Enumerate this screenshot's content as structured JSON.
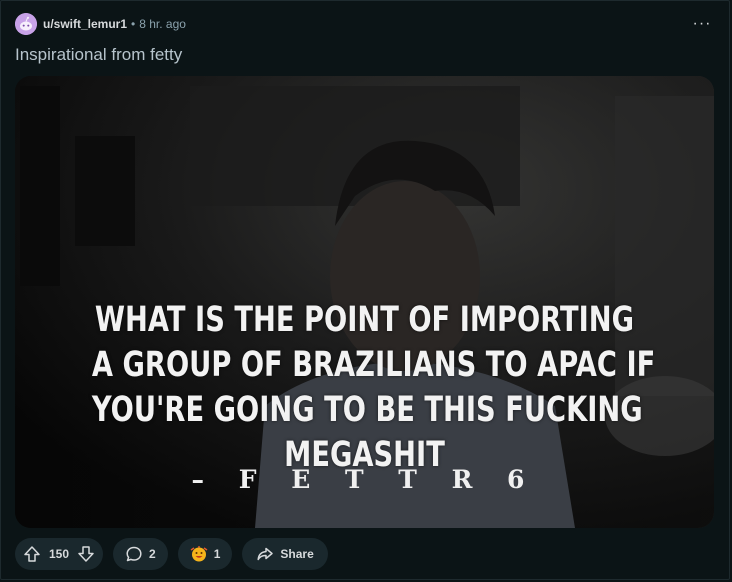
{
  "post": {
    "author": "u/swift_lemur1",
    "separator": "•",
    "time": "8 hr. ago",
    "more_label": "···",
    "title": "Inspirational from fetty",
    "media": {
      "caption_lines": [
        "WHAT IS THE POINT OF IMPORTING",
        "A GROUP OF BRAZILIANS TO APAC IF",
        "YOU'RE GOING TO BE THIS FUCKING",
        "MEGASHIT"
      ],
      "signature": "– F E T T R 6"
    },
    "actions": {
      "upvotes": "150",
      "comments": "2",
      "awards": "1",
      "share_label": "Share"
    }
  },
  "colors": {
    "background": "#0b1416",
    "pill": "#1a282d",
    "muted_text": "#8ba2ad",
    "avatar": "#c8a2e8"
  },
  "icons": {
    "avatar": "reddit-snoo-icon",
    "more": "more-horizontal-icon",
    "upvote": "upvote-arrow-icon",
    "downvote": "downvote-arrow-icon",
    "comment": "comment-bubble-icon",
    "award": "award-emoji-icon",
    "share": "share-arrow-icon"
  }
}
